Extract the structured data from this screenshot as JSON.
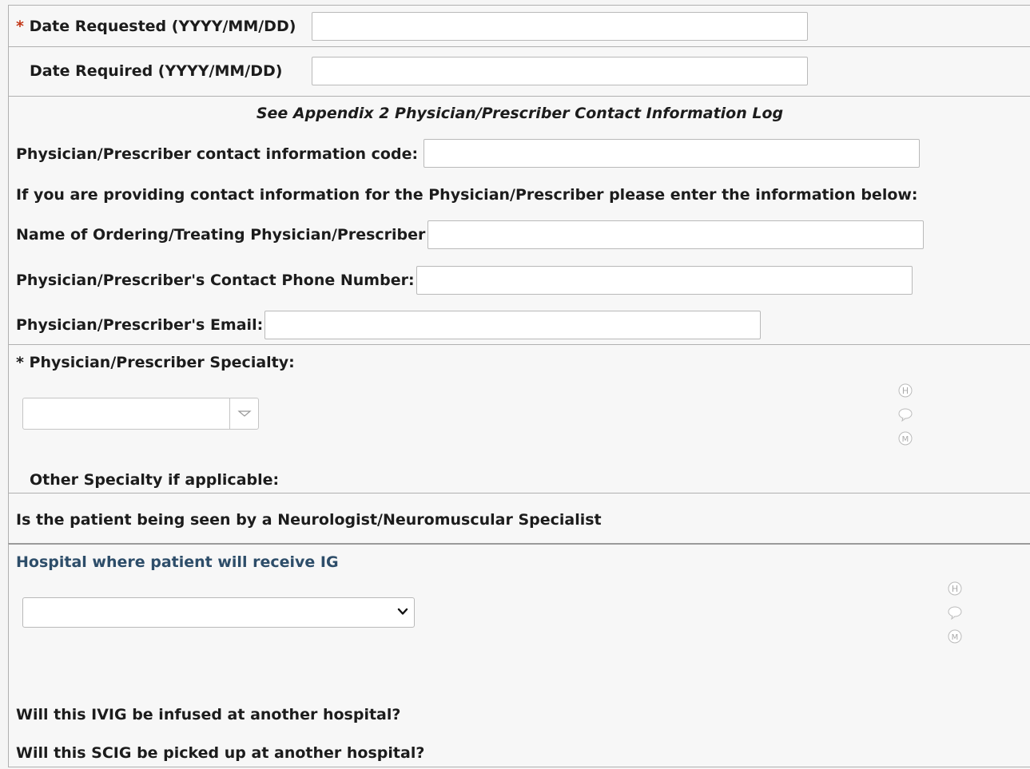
{
  "date_requested": {
    "required_mark": "*",
    "label": "Date Requested (YYYY/MM/DD)",
    "value": ""
  },
  "date_required": {
    "label": "Date Required (YYYY/MM/DD)",
    "value": ""
  },
  "physician": {
    "note": "See Appendix 2 Physician/Prescriber Contact Information Log",
    "code_label": "Physician/Prescriber contact information code:",
    "code_value": "",
    "info_intro": "If you are providing contact information for the Physician/Prescriber please enter the information below:",
    "name_label": "Name of Ordering/Treating Physician/Prescriber",
    "name_value": "",
    "phone_label": "Physician/Prescriber's Contact Phone Number:",
    "phone_value": "",
    "email_label": "Physician/Prescriber's Email:",
    "email_value": ""
  },
  "specialty": {
    "label": "* Physician/Prescriber Specialty:",
    "selected": "",
    "other_label": "Other Specialty if applicable:",
    "side_icons": [
      "history-icon",
      "comment-icon",
      "missing-data-icon"
    ],
    "side_letters": [
      "H",
      "M"
    ]
  },
  "neurologist": {
    "label": "Is the patient being seen by a Neurologist/Neuromuscular Specialist"
  },
  "hospital": {
    "label": "Hospital where patient will receive IG",
    "selected": "",
    "side_icons": [
      "history-icon",
      "comment-icon",
      "missing-data-icon"
    ],
    "side_letters": [
      "H",
      "M"
    ],
    "ivig_label": "Will this IVIG be infused at another hospital?",
    "scig_label": "Will this SCIG be picked up at another hospital?"
  },
  "colors": {
    "required": "#c23616",
    "hospital_label": "#2d4d69",
    "border": "#b0b0b0"
  }
}
